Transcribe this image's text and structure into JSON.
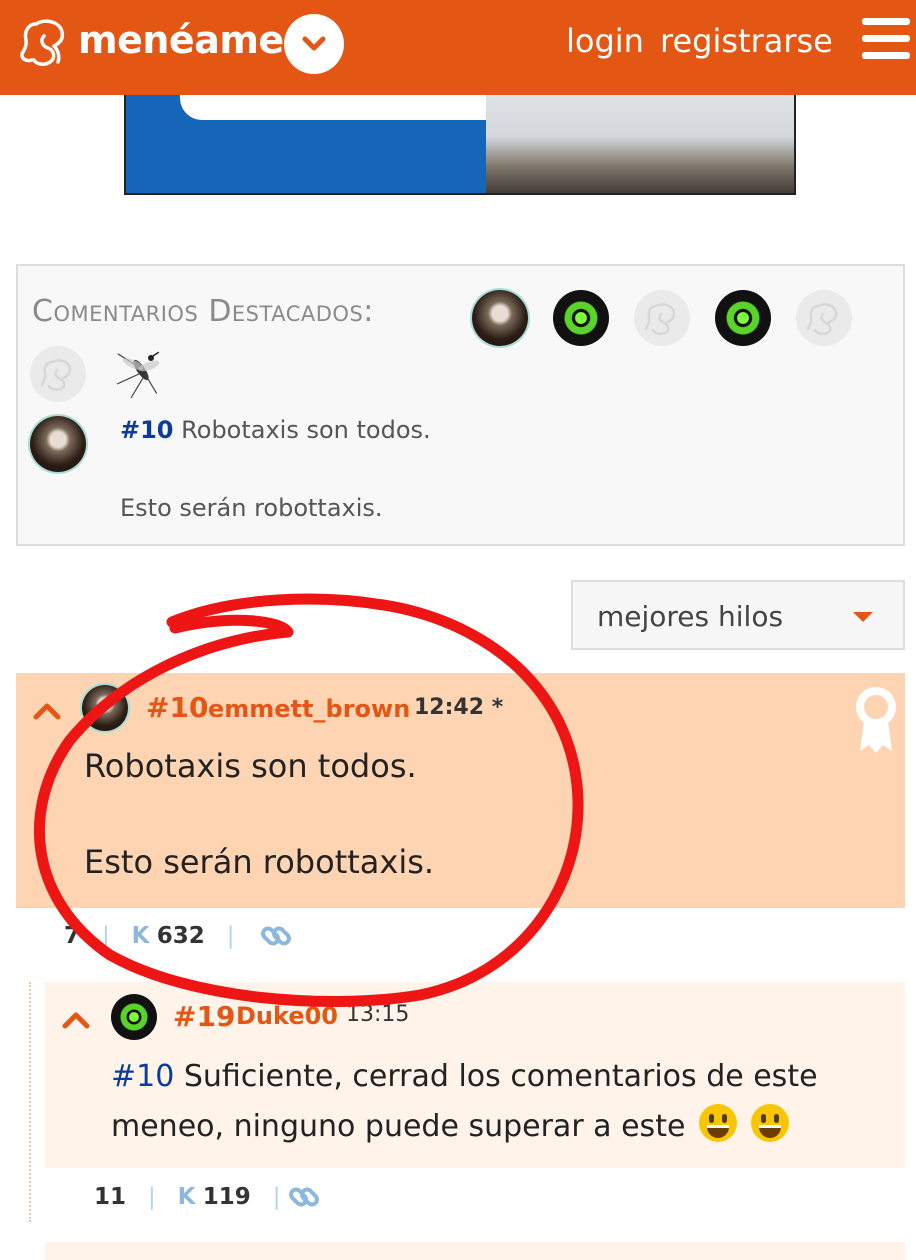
{
  "header": {
    "logo_text": "menéame",
    "login": "login",
    "register": "registrarse",
    "icons": [
      "meneame-logo-icon",
      "chevron-down-icon",
      "hamburger-menu-icon"
    ],
    "accent_color": "#e35614"
  },
  "featured": {
    "title": "Comentarios Destacados:",
    "avatars": [
      "avatar-emmett",
      "avatar-biohazard",
      "avatar-default",
      "avatar-biohazard",
      "avatar-default",
      "avatar-default",
      "avatar-mosquito"
    ],
    "preview": {
      "number": "#10",
      "title": "Robotaxis son todos.",
      "body": "Esto serán robottaxis."
    }
  },
  "sort": {
    "selected": "mejores hilos"
  },
  "comments": [
    {
      "number": "#10",
      "user": "emmett_brown",
      "time": "12:42 *",
      "line1": "Robotaxis son todos.",
      "line2": "Esto serán robottaxis.",
      "votes": "7",
      "karma_label": "K",
      "karma": "632"
    },
    {
      "number": "#19",
      "user": "Duke00",
      "time": "13:15",
      "ref": "#10",
      "text": "Suficiente, cerrad los comentarios de este meneo, ninguno puede superar a este",
      "votes": "11",
      "karma_label": "K",
      "karma": "119"
    }
  ]
}
